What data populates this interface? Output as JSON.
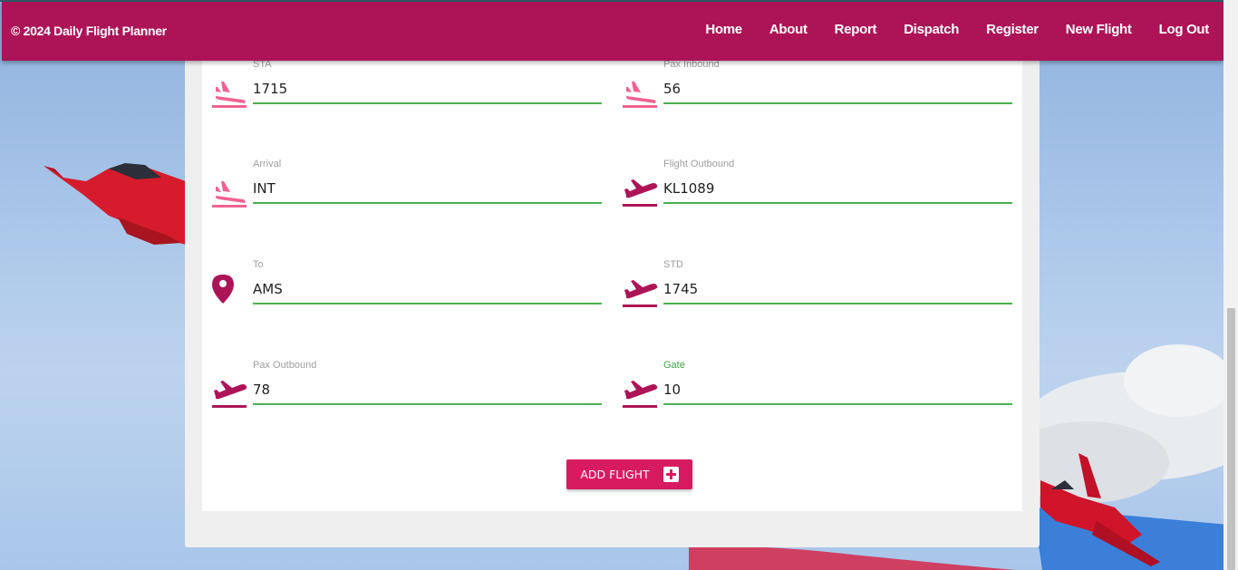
{
  "navbar": {
    "brand": "© 2024 Daily Flight Planner",
    "links": [
      "Home",
      "About",
      "Report",
      "Dispatch",
      "Register",
      "New Flight",
      "Log Out"
    ]
  },
  "form": {
    "fields": [
      {
        "label": "STA",
        "value": "1715",
        "icon": "flight-land-icon"
      },
      {
        "label": "Pax Inbound",
        "value": "56",
        "icon": "flight-land-icon"
      },
      {
        "label": "Arrival",
        "value": "INT",
        "icon": "flight-land-icon"
      },
      {
        "label": "Flight Outbound",
        "value": "KL1089",
        "icon": "flight-takeoff-icon"
      },
      {
        "label": "To",
        "value": "AMS",
        "icon": "location-pin-icon"
      },
      {
        "label": "STD",
        "value": "1745",
        "icon": "flight-takeoff-icon"
      },
      {
        "label": "Pax Outbound",
        "value": "78",
        "icon": "flight-takeoff-icon"
      },
      {
        "label": "Gate",
        "value": "10",
        "icon": "flight-takeoff-icon"
      }
    ],
    "submit_label": "ADD FLIGHT",
    "submit_icon": "plus-box-icon"
  },
  "colors": {
    "navbar": "#ad1457",
    "button": "#d81b60",
    "input_underline": "#4caf50",
    "icon_land": "#f06292",
    "icon_takeoff": "#ad1457"
  }
}
